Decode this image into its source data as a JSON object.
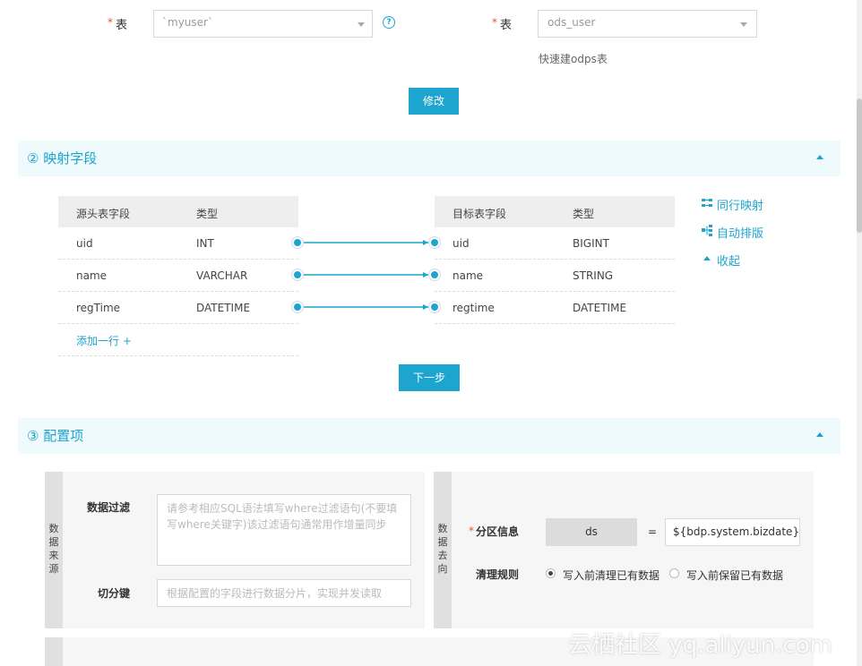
{
  "source": {
    "required_mark": "*",
    "label": "表",
    "value": "`myuser`",
    "help_icon": "?"
  },
  "target": {
    "required_mark": "*",
    "label": "表",
    "value": "ods_user",
    "quick_create_link": "快速建odps表"
  },
  "modify_button": "修改",
  "mapping_section": {
    "title": "② 映射字段",
    "source_table": {
      "headers": [
        "源头表字段",
        "类型"
      ],
      "rows": [
        {
          "field": "uid",
          "type": "INT"
        },
        {
          "field": "name",
          "type": "VARCHAR"
        },
        {
          "field": "regTime",
          "type": "DATETIME"
        }
      ],
      "add_row": "添加一行 +"
    },
    "target_table": {
      "headers": [
        "目标表字段",
        "类型"
      ],
      "rows": [
        {
          "field": "uid",
          "type": "BIGINT"
        },
        {
          "field": "name",
          "type": "STRING"
        },
        {
          "field": "regtime",
          "type": "DATETIME"
        }
      ]
    },
    "actions": {
      "same_row_mapping": "同行映射",
      "auto_layout": "自动排版",
      "collapse": "收起"
    },
    "next_button": "下一步"
  },
  "config_section": {
    "title": "③ 配置项",
    "source_panel": {
      "side_label": "数据来源",
      "filter_label": "数据过滤",
      "filter_placeholder": "请参考相应SQL语法填写where过滤语句(不要填写where关键字)该过滤语句通常用作增量同步",
      "split_label": "切分键",
      "split_placeholder": "根据配置的字段进行数据分片，实现并发读取"
    },
    "target_panel": {
      "side_label": "数据去向",
      "partition_required": "*",
      "partition_label": "分区信息",
      "partition_key": "ds",
      "equals": "=",
      "partition_value": "${bdp.system.bizdate}",
      "clean_rule_label": "清理规则",
      "options": [
        "写入前清理已有数据",
        "写入前保留已有数据"
      ],
      "selected_option": "写入前清理已有数据"
    }
  },
  "watermark": "云栖社区 yq.aliyun.com",
  "colors": {
    "accent": "#1da5cf",
    "required": "#e0582a",
    "section_bg": "#eefafc"
  }
}
